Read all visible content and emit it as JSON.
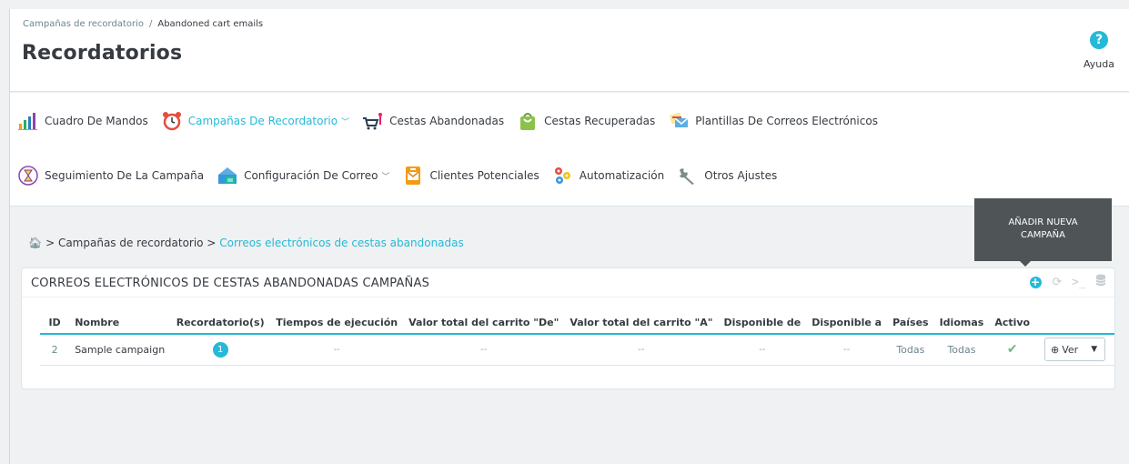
{
  "breadcrumb": {
    "parent": "Campañas de recordatorio",
    "separator": "/",
    "current": "Abandoned cart emails"
  },
  "page_title": "Recordatorios",
  "help": {
    "icon": "question-icon",
    "label": "Ayuda"
  },
  "nav": {
    "row1": [
      {
        "label": "Cuadro De Mandos",
        "icon": "bar-chart-icon"
      },
      {
        "label": "Campañas De Recordatorio",
        "icon": "alarm-clock-icon",
        "active": true,
        "dropdown": true
      },
      {
        "label": "Cestas Abandonadas",
        "icon": "shopping-cart-icon"
      },
      {
        "label": "Cestas Recuperadas",
        "icon": "shopping-bag-icon"
      },
      {
        "label": "Plantillas De Correos Electrónicos",
        "icon": "email-templates-icon"
      }
    ],
    "row2": [
      {
        "label": "Seguimiento De La Campaña",
        "icon": "hourglass-icon"
      },
      {
        "label": "Configuración De Correo",
        "icon": "mail-server-icon",
        "dropdown": true
      },
      {
        "label": "Clientes Potenciales",
        "icon": "envelope-icon"
      },
      {
        "label": "Automatización",
        "icon": "gears-icon"
      },
      {
        "label": "Otros Ajustes",
        "icon": "wrench-icon"
      }
    ]
  },
  "content_breadcrumb": {
    "sep": ">",
    "item1": "Campañas de recordatorio",
    "item2": "Correos electrónicos de cestas abandonadas"
  },
  "tooltip": {
    "line1": "AÑADIR NUEVA",
    "line2": "CAMPAÑA"
  },
  "panel": {
    "title": "CORREOS ELECTRÓNICOS DE CESTAS ABANDONADAS CAMPAÑAS",
    "toolbar": [
      "add-icon",
      "refresh-icon",
      "terminal-icon",
      "database-icon"
    ]
  },
  "table": {
    "headers": {
      "id": "ID",
      "name": "Nombre",
      "reminders": "Recordatorio(s)",
      "exec_times": "Tiempos de ejecución",
      "cart_from": "Valor total del carrito \"De\"",
      "cart_to": "Valor total del carrito \"A\"",
      "avail_from": "Disponible de",
      "avail_to": "Disponible a",
      "countries": "Países",
      "languages": "Idiomas",
      "active": "Activo"
    },
    "row": {
      "id": "2",
      "name": "Sample campaign",
      "reminders": "1",
      "exec_times": "--",
      "cart_from": "--",
      "cart_to": "--",
      "avail_from": "--",
      "avail_to": "--",
      "countries": "Todas",
      "languages": "Todas",
      "active": "✔",
      "view_label": "Ver"
    }
  },
  "colors": {
    "accent": "#25b9d7",
    "success": "#70b580",
    "tooltip_bg": "#4f5456"
  }
}
